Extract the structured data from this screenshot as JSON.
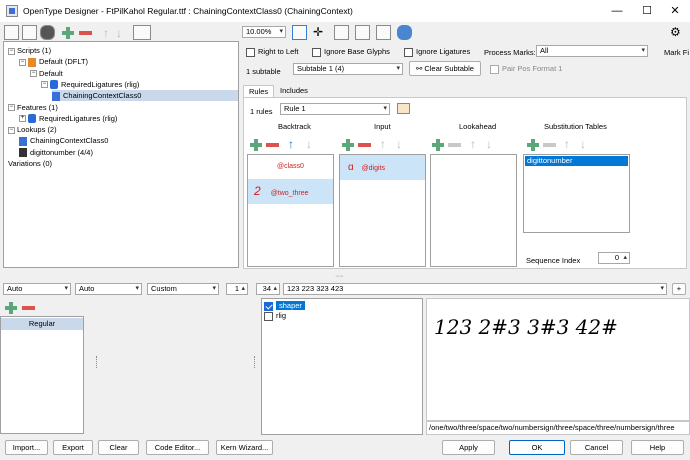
{
  "window": {
    "title": "OpenType Designer - FtPilKahol Regular.ttf : ChainingContextClass0 (ChainingContext)",
    "controls": {
      "minimize": "—",
      "maximize": "☐",
      "close": "✕"
    }
  },
  "toolbar": {
    "zoom": "10.00%"
  },
  "tree": {
    "rows": [
      {
        "label": "Scripts (1)",
        "expander": "−",
        "icon": "none",
        "indent": 0
      },
      {
        "label": "Default (DFLT)",
        "expander": "−",
        "icon": "doc",
        "indent": 1
      },
      {
        "label": "Default",
        "expander": "−",
        "icon": "none",
        "indent": 2
      },
      {
        "label": "RequiredLigatures (rlig)",
        "expander": "−",
        "icon": "check",
        "indent": 3
      },
      {
        "label": "ChainingContextClass0",
        "expander": "",
        "icon": "lookup",
        "indent": 4
      },
      {
        "label": "Features (1)",
        "expander": "−",
        "icon": "none",
        "indent": 0
      },
      {
        "label": "RequiredLigatures (rlig)",
        "expander": "+",
        "icon": "check",
        "indent": 1
      },
      {
        "label": "Lookups (2)",
        "expander": "−",
        "icon": "none",
        "indent": 0
      },
      {
        "label": "ChainingContextClass0",
        "expander": "",
        "icon": "lookup",
        "indent": 1
      },
      {
        "label": "digittonumber (4/4)",
        "expander": "",
        "icon": "s-icon",
        "indent": 1
      },
      {
        "label": "Variations (0)",
        "expander": "",
        "icon": "none",
        "indent": 0
      }
    ]
  },
  "options": {
    "right_to_left": "Right to Left",
    "ignore_base": "Ignore Base Glyphs",
    "ignore_ligatures": "Ignore Ligatures",
    "process_marks_label": "Process Marks:",
    "process_marks_value": "All",
    "mark_filter": "Mark Fi",
    "subtable_count": "1 subtable",
    "subtable_value": "Subtable 1 (4)",
    "clear_subtable": "Clear Subtable",
    "pair_pos": "Pair Pos Format 1"
  },
  "tabs": {
    "rules": "Rules",
    "includes": "Includes"
  },
  "rules": {
    "count": "1 rules",
    "selected": "Rule 1",
    "headers": {
      "backtrack": "Backtrack",
      "input": "Input",
      "lookahead": "Lookahead",
      "subst": "Substitution Tables"
    },
    "backtrack": [
      {
        "glyph": "",
        "label": "@class0"
      },
      {
        "glyph": "2",
        "label": "@two_three"
      }
    ],
    "input": [
      {
        "glyph": "ɑ",
        "label": "@digits"
      }
    ],
    "subst": [
      "digittonumber"
    ],
    "sequence_label": "Sequence Index",
    "sequence_value": "0"
  },
  "preview_bar": {
    "script": "Auto",
    "language": "Auto",
    "mode": "Custom",
    "size_a": "1",
    "size_b": "34",
    "text": "123 223 323 423"
  },
  "lower": {
    "style": "Regular",
    "features": [
      {
        "label": "shaper",
        "checked": true
      },
      {
        "label": "rlig",
        "checked": false
      }
    ],
    "preview_text": "123  2#3  3#3  42#",
    "glyph_path": "/one/two/three/space/two/numbersign/three/space/three/numbersign/three"
  },
  "buttons": {
    "import": "Import...",
    "export": "Export",
    "clear": "Clear",
    "code_editor": "Code Editor...",
    "kern_wizard": "Kern Wizard...",
    "apply": "Apply",
    "ok": "OK",
    "cancel": "Cancel",
    "help": "Help"
  },
  "colors": {
    "accent": "#0067c0",
    "selection": "#cce4f7",
    "class_red": "#d02020",
    "add_green": "#5ca77a",
    "remove_red": "#d9534f"
  }
}
